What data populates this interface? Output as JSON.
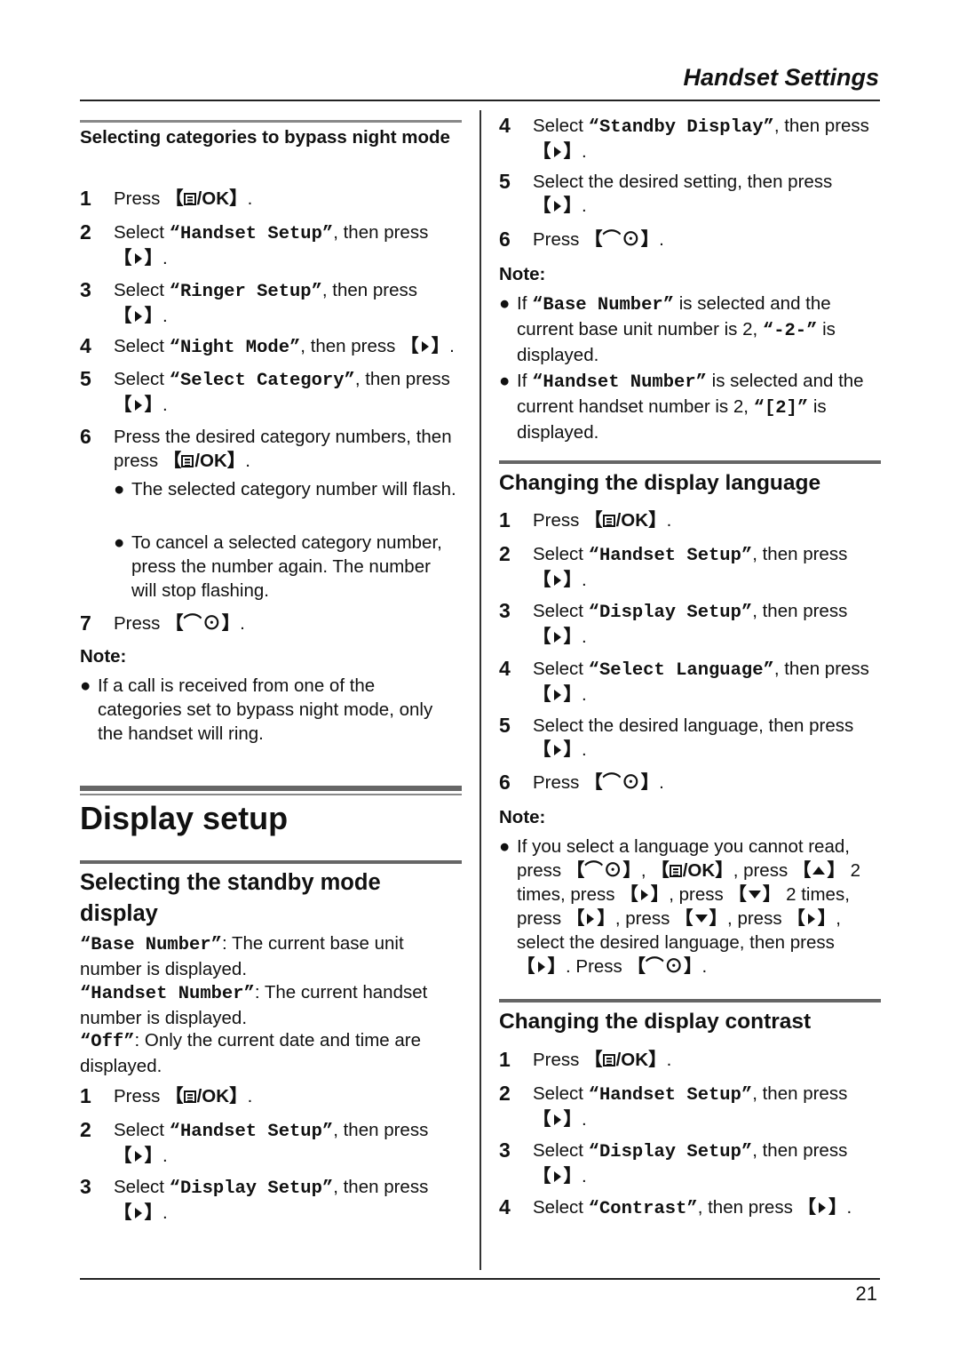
{
  "header": {
    "title": "Handset Settings"
  },
  "footer": {
    "page_number": "21"
  },
  "keys": {
    "menu_ok": "/OK",
    "off_symbol": "⌒⊙",
    "open": "【",
    "close": "】"
  },
  "left": {
    "bypass": {
      "heading": "Selecting categories to bypass night mode",
      "steps": [
        {
          "n": "1",
          "pre": "Press ",
          "key": "menu_ok",
          "post": "."
        },
        {
          "n": "2",
          "pre": "Select ",
          "item": "“Handset Setup”",
          "mid": ", then press ",
          "key": "right",
          "post": "."
        },
        {
          "n": "3",
          "pre": "Select ",
          "item": "“Ringer Setup”",
          "mid": ", then press ",
          "key": "right",
          "post": "."
        },
        {
          "n": "4",
          "pre": "Select ",
          "item": "“Night Mode”",
          "mid": ", then press ",
          "key": "right",
          "post": "."
        },
        {
          "n": "5",
          "pre": "Select ",
          "item": "“Select Category”",
          "mid": ", then press ",
          "key": "right",
          "post": "."
        },
        {
          "n": "6",
          "pre": "Press the desired category numbers, then press ",
          "key": "menu_ok",
          "post": "."
        },
        {
          "n": "7",
          "pre": "Press ",
          "key": "off",
          "post": "."
        }
      ],
      "sub_bullets": [
        "The selected category number will flash.",
        "To cancel a selected category number, press the number again. The number will stop flashing."
      ],
      "note_label": "Note:",
      "notes": [
        "If a call is received from one of the categories set to bypass night mode, only the handset will ring."
      ]
    },
    "display_setup": {
      "title": "Display setup"
    },
    "standby": {
      "heading": "Selecting the standby mode display",
      "options": [
        {
          "item": "“Base Number”",
          "desc": ": The current base unit number is displayed."
        },
        {
          "item": "“Handset Number”",
          "desc": ": The current handset number is displayed."
        },
        {
          "item": "“Off”",
          "desc": ": Only the current date and time are displayed."
        }
      ],
      "steps": [
        {
          "n": "1",
          "pre": "Press ",
          "key": "menu_ok",
          "post": "."
        },
        {
          "n": "2",
          "pre": "Select ",
          "item": "“Handset Setup”",
          "mid": ", then press ",
          "key": "right",
          "post": "."
        },
        {
          "n": "3",
          "pre": "Select ",
          "item": "“Display Setup”",
          "mid": ", then press ",
          "key": "right",
          "post": "."
        }
      ]
    }
  },
  "right": {
    "standby_cont": {
      "steps": [
        {
          "n": "4",
          "pre": "Select ",
          "item": "“Standby Display”",
          "mid": ", then press ",
          "key": "right",
          "post": "."
        },
        {
          "n": "5",
          "pre": "Select the desired setting, then press ",
          "key": "right",
          "post": "."
        },
        {
          "n": "6",
          "pre": "Press ",
          "key": "off",
          "post": "."
        }
      ],
      "note_label": "Note:",
      "notes": [
        {
          "pre": "If ",
          "item": "“Base Number”",
          "mid": " is selected and the current base unit number is 2, ",
          "item2": "“-2-”",
          "post": " is displayed."
        },
        {
          "pre": "If ",
          "item": "“Handset Number”",
          "mid": " is selected and the current handset number is 2, ",
          "item2": "“[2]”",
          "post": " is displayed."
        }
      ]
    },
    "language": {
      "heading": "Changing the display language",
      "steps": [
        {
          "n": "1",
          "pre": "Press ",
          "key": "menu_ok",
          "post": "."
        },
        {
          "n": "2",
          "pre": "Select ",
          "item": "“Handset Setup”",
          "mid": ", then press ",
          "key": "right",
          "post": "."
        },
        {
          "n": "3",
          "pre": "Select ",
          "item": "“Display Setup”",
          "mid": ", then press ",
          "key": "right",
          "post": "."
        },
        {
          "n": "4",
          "pre": "Select ",
          "item": "“Select Language”",
          "mid": ", then press ",
          "key": "right",
          "post": "."
        },
        {
          "n": "5",
          "pre": "Select the desired language, then press ",
          "key": "right",
          "post": "."
        },
        {
          "n": "6",
          "pre": "Press ",
          "key": "off",
          "post": "."
        }
      ],
      "note_label": "Note:",
      "note_text": "If you select a language you cannot read, press [off], [menu/OK], press [up] 2 times, press [right], press [down] 2 times, press [right], press [down], press [right], select the desired language, then press [right]. Press [off]."
    },
    "contrast": {
      "heading": "Changing the display contrast",
      "steps": [
        {
          "n": "1",
          "pre": "Press ",
          "key": "menu_ok",
          "post": "."
        },
        {
          "n": "2",
          "pre": "Select ",
          "item": "“Handset Setup”",
          "mid": ", then press ",
          "key": "right",
          "post": "."
        },
        {
          "n": "3",
          "pre": "Select ",
          "item": "“Display Setup”",
          "mid": ", then press ",
          "key": "right",
          "post": "."
        },
        {
          "n": "4",
          "pre": "Select ",
          "item": "“Contrast”",
          "mid": ", then press ",
          "key": "right",
          "post": "."
        }
      ]
    }
  }
}
